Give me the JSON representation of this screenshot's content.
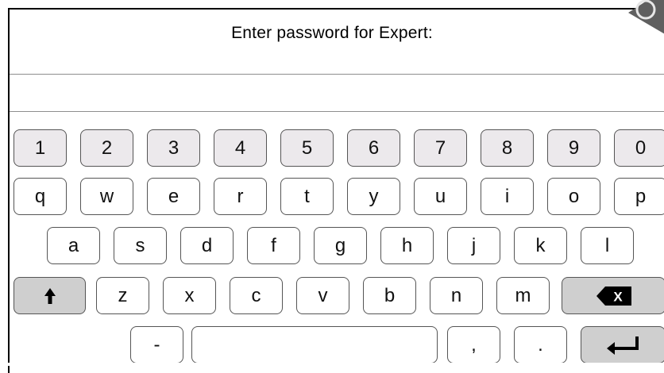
{
  "dialog": {
    "prompt": "Enter password for Expert:"
  },
  "password_field": {
    "value": ""
  },
  "keyboard": {
    "number_row": [
      "1",
      "2",
      "3",
      "4",
      "5",
      "6",
      "7",
      "8",
      "9",
      "0"
    ],
    "row1": [
      "q",
      "w",
      "e",
      "r",
      "t",
      "y",
      "u",
      "i",
      "o",
      "p"
    ],
    "row2": [
      "a",
      "s",
      "d",
      "f",
      "g",
      "h",
      "j",
      "k",
      "l"
    ],
    "row3": [
      "z",
      "x",
      "c",
      "v",
      "b",
      "n",
      "m"
    ],
    "row4": {
      "dash": "-",
      "comma": ",",
      "period": "."
    },
    "backspace_glyph": "X"
  },
  "icons": {
    "shift": "shift-up-arrow",
    "backspace": "backspace-x",
    "enter": "enter-return-arrow",
    "corner": "close-icon"
  }
}
